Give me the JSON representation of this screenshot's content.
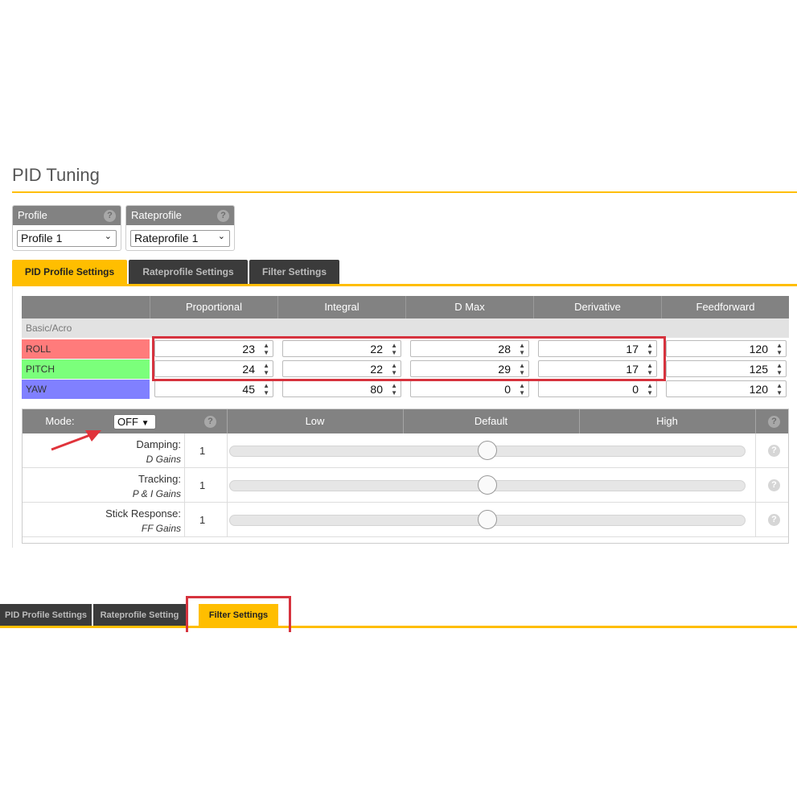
{
  "page": {
    "title": "PID Tuning"
  },
  "profile": {
    "label": "Profile",
    "selected": "Profile 1",
    "help": "?"
  },
  "rateprofile": {
    "label": "Rateprofile",
    "selected": "Rateprofile 1",
    "help": "?"
  },
  "tabs": [
    {
      "label": "PID Profile Settings",
      "active": true
    },
    {
      "label": "Rateprofile Settings",
      "active": false
    },
    {
      "label": "Filter Settings",
      "active": false
    }
  ],
  "pid_table": {
    "columns": [
      "Proportional",
      "Integral",
      "D Max",
      "Derivative",
      "Feedforward"
    ],
    "section": "Basic/Acro",
    "rows": [
      {
        "axis": "ROLL",
        "color": "#ff7b7b",
        "values": [
          "23",
          "22",
          "28",
          "17",
          "120"
        ]
      },
      {
        "axis": "PITCH",
        "color": "#7bff7b",
        "values": [
          "24",
          "22",
          "29",
          "17",
          "125"
        ]
      },
      {
        "axis": "YAW",
        "color": "#8080ff",
        "values": [
          "45",
          "80",
          "0",
          "0",
          "120"
        ]
      }
    ]
  },
  "slider_table": {
    "mode_label": "Mode:",
    "mode_value": "OFF",
    "columns": [
      "Low",
      "Default",
      "High"
    ],
    "rows": [
      {
        "label": "Damping:",
        "sub": "D Gains",
        "value": "1",
        "position": 0.5
      },
      {
        "label": "Tracking:",
        "sub": "P & I Gains",
        "value": "1",
        "position": 0.5
      },
      {
        "label": "Stick Response:",
        "sub": "FF Gains",
        "value": "1",
        "position": 0.5
      }
    ]
  },
  "bottom_tabs": [
    {
      "label": "PID Profile Settings",
      "active": false
    },
    {
      "label": "Rateprofile Setting",
      "active": false
    },
    {
      "label": "Filter Settings",
      "active": true
    }
  ],
  "colors": {
    "accent": "#ffbe00",
    "highlight": "#d6333e",
    "header": "#828282"
  }
}
